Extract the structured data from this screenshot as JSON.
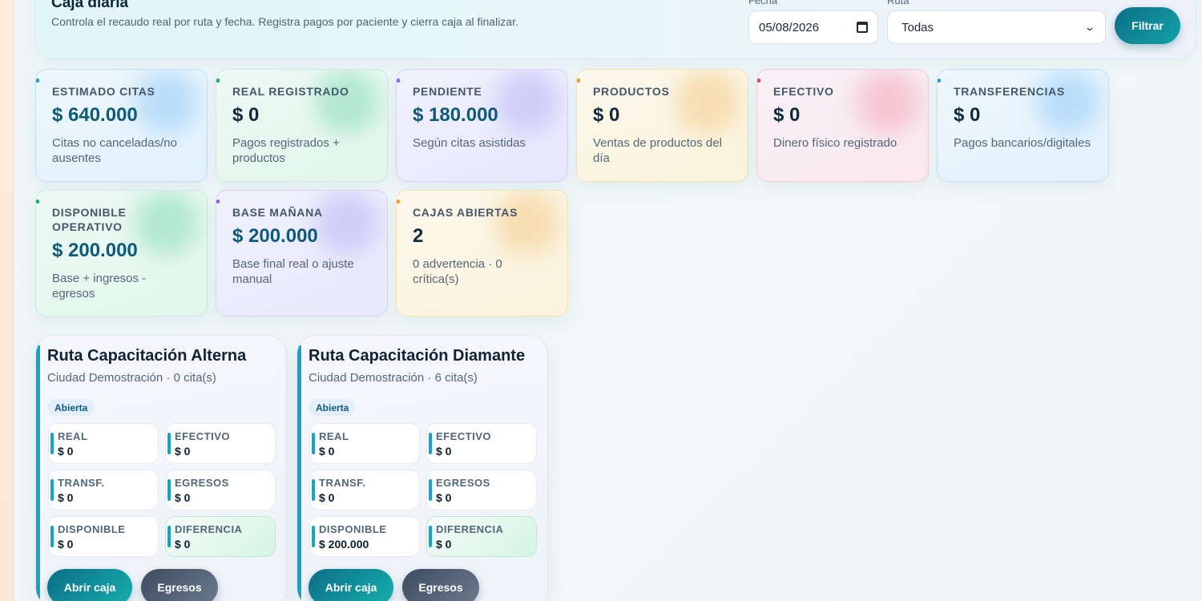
{
  "header": {
    "title": "Caja diaria",
    "subtitle": "Controla el recaudo real por ruta y fecha. Registra pagos por paciente y cierra caja al finalizar."
  },
  "filters": {
    "date_label": "Fecha",
    "date_value": "05/08/2026",
    "route_label": "Ruta",
    "route_value": "Todas",
    "filter_button": "Filtrar"
  },
  "stats": [
    {
      "label": "Estimado citas",
      "value": "$ 640.000",
      "desc": "Citas no canceladas/no ausentes",
      "color": "#1e9bd0"
    },
    {
      "label": "Real registrado",
      "value": "$ 0",
      "desc": "Pagos registrados + productos",
      "color": "#17a87a"
    },
    {
      "label": "Pendiente",
      "value": "$ 180.000",
      "desc": "Según citas asistidas",
      "color": "#8b5cf6"
    },
    {
      "label": "Productos",
      "value": "$ 0",
      "desc": "Ventas de productos del día",
      "color": "#f09a1a"
    },
    {
      "label": "Efectivo",
      "value": "$ 0",
      "desc": "Dinero físico registrado",
      "color": "#e0435f"
    },
    {
      "label": "Transferencias",
      "value": "$ 0",
      "desc": "Pagos bancarios/digitales",
      "color": "#1e9bd0"
    },
    {
      "label": "Disponible operativo",
      "value": "$ 200.000",
      "desc": "Base + ingresos - egresos",
      "color": "#17a87a"
    },
    {
      "label": "Base mañana",
      "value": "$ 200.000",
      "desc": "Base final real o ajuste manual",
      "color": "#8b5cf6"
    },
    {
      "label": "Cajas abiertas",
      "value": "2",
      "desc": "0 advertencia · 0 crítica(s)",
      "color": "#f09a1a"
    }
  ],
  "routes": [
    {
      "title": "Ruta Capacitación Alterna",
      "subtitle": "Ciudad Demostración · 0 cita(s)",
      "status": "Abierta",
      "metrics": [
        {
          "label": "Real",
          "value": "$ 0"
        },
        {
          "label": "Efectivo",
          "value": "$ 0"
        },
        {
          "label": "Transf.",
          "value": "$ 0"
        },
        {
          "label": "Egresos",
          "value": "$ 0"
        },
        {
          "label": "Disponible",
          "value": "$ 0"
        },
        {
          "label": "Diferencia",
          "value": "$ 0"
        }
      ],
      "open_button": "Abrir caja",
      "expenses_button": "Egresos"
    },
    {
      "title": "Ruta Capacitación Diamante",
      "subtitle": "Ciudad Demostración · 6 cita(s)",
      "status": "Abierta",
      "metrics": [
        {
          "label": "Real",
          "value": "$ 0"
        },
        {
          "label": "Efectivo",
          "value": "$ 0"
        },
        {
          "label": "Transf.",
          "value": "$ 0"
        },
        {
          "label": "Egresos",
          "value": "$ 0"
        },
        {
          "label": "Disponible",
          "value": "$ 200.000"
        },
        {
          "label": "Diferencia",
          "value": "$ 0"
        }
      ],
      "open_button": "Abrir caja",
      "expenses_button": "Egresos"
    }
  ]
}
